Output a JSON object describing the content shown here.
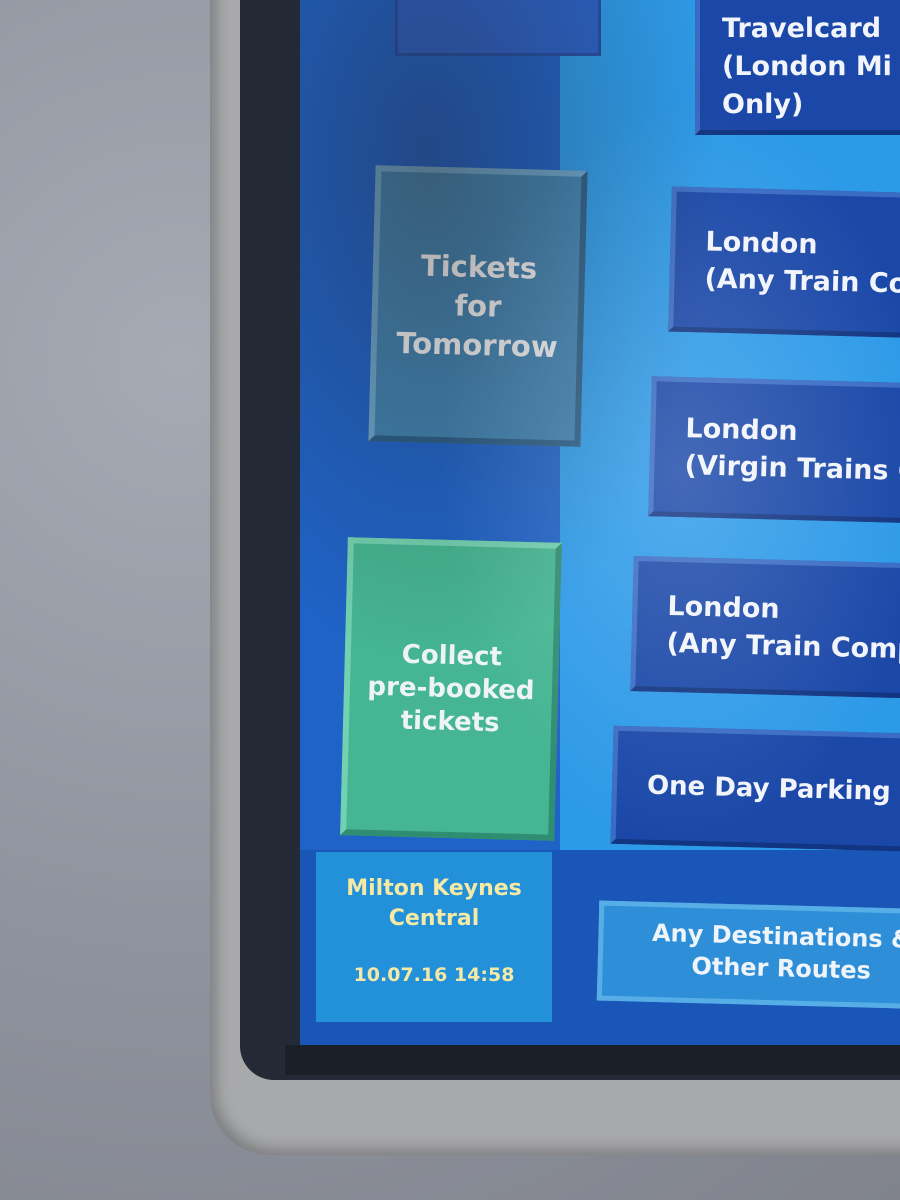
{
  "station": {
    "name": "Milton Keynes\nCentral",
    "datetime": "10.07.16 14:58"
  },
  "left_buttons": {
    "tomorrow": "Tickets\nfor\nTomorrow",
    "collect": "Collect\npre-booked\ntickets"
  },
  "destinations": [
    {
      "label": "London On\nTravelcard\n(London Mi\nOnly)"
    },
    {
      "label": "London\n(Any Train Co"
    },
    {
      "label": "London\n(Virgin Trains O"
    },
    {
      "label": "London\n(Any Train Compa"
    },
    {
      "label": "One Day Parking"
    }
  ],
  "any_destinations": "Any Destinations &\nOther Routes",
  "colors": {
    "screen_blue": "#1d6fd1",
    "destination_button": "#1b48a8",
    "collect_button": "#45b592",
    "tomorrow_button": "#3f83b3",
    "station_text": "#f4e9a5"
  }
}
